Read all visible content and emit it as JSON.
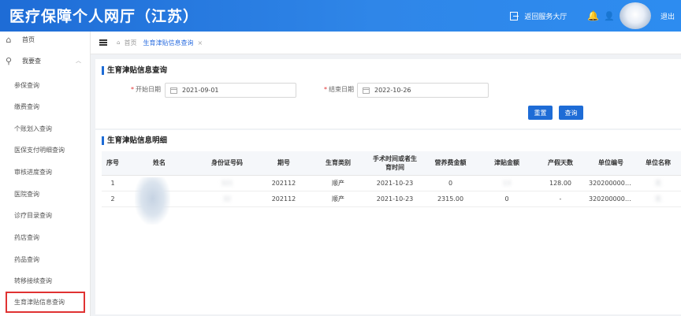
{
  "app": {
    "title": "医疗保障个人网厅（江苏）"
  },
  "header": {
    "return_label": "返回服务大厅",
    "logout_label": "退出"
  },
  "sidebar": {
    "home": "首页",
    "group": "我要查",
    "items": [
      "参保查询",
      "缴费查询",
      "个账划入查询",
      "医保支付明细查询",
      "审核进度查询",
      "医院查询",
      "诊疗目录查询",
      "药店查询",
      "药品查询",
      "转移接续查询",
      "生育津贴信息查询"
    ]
  },
  "tabs": {
    "home": "首页",
    "current": "生育津贴信息查询"
  },
  "query": {
    "title": "生育津贴信息查询",
    "start_label": "开始日期",
    "start_value": "2021-09-01",
    "end_label": "结束日期",
    "end_value": "2022-10-26",
    "reset_label": "重置",
    "search_label": "查询"
  },
  "detail": {
    "title": "生育津贴信息明细",
    "columns": [
      "序号",
      "姓名",
      "身份证号码",
      "期号",
      "生育类别",
      "手术时间或者生育时间",
      "营养费金额",
      "津贴金额",
      "产假天数",
      "单位编号",
      "单位名称"
    ],
    "rows": [
      [
        "1",
        "",
        "321",
        "202112",
        "顺产",
        "2021-10-23",
        "0",
        "13",
        "128.00",
        "32020000000...",
        "无"
      ],
      [
        "2",
        "",
        "32",
        "202112",
        "顺产",
        "2021-10-23",
        "2315.00",
        "0",
        "-",
        "32020000000...",
        "无"
      ]
    ]
  }
}
